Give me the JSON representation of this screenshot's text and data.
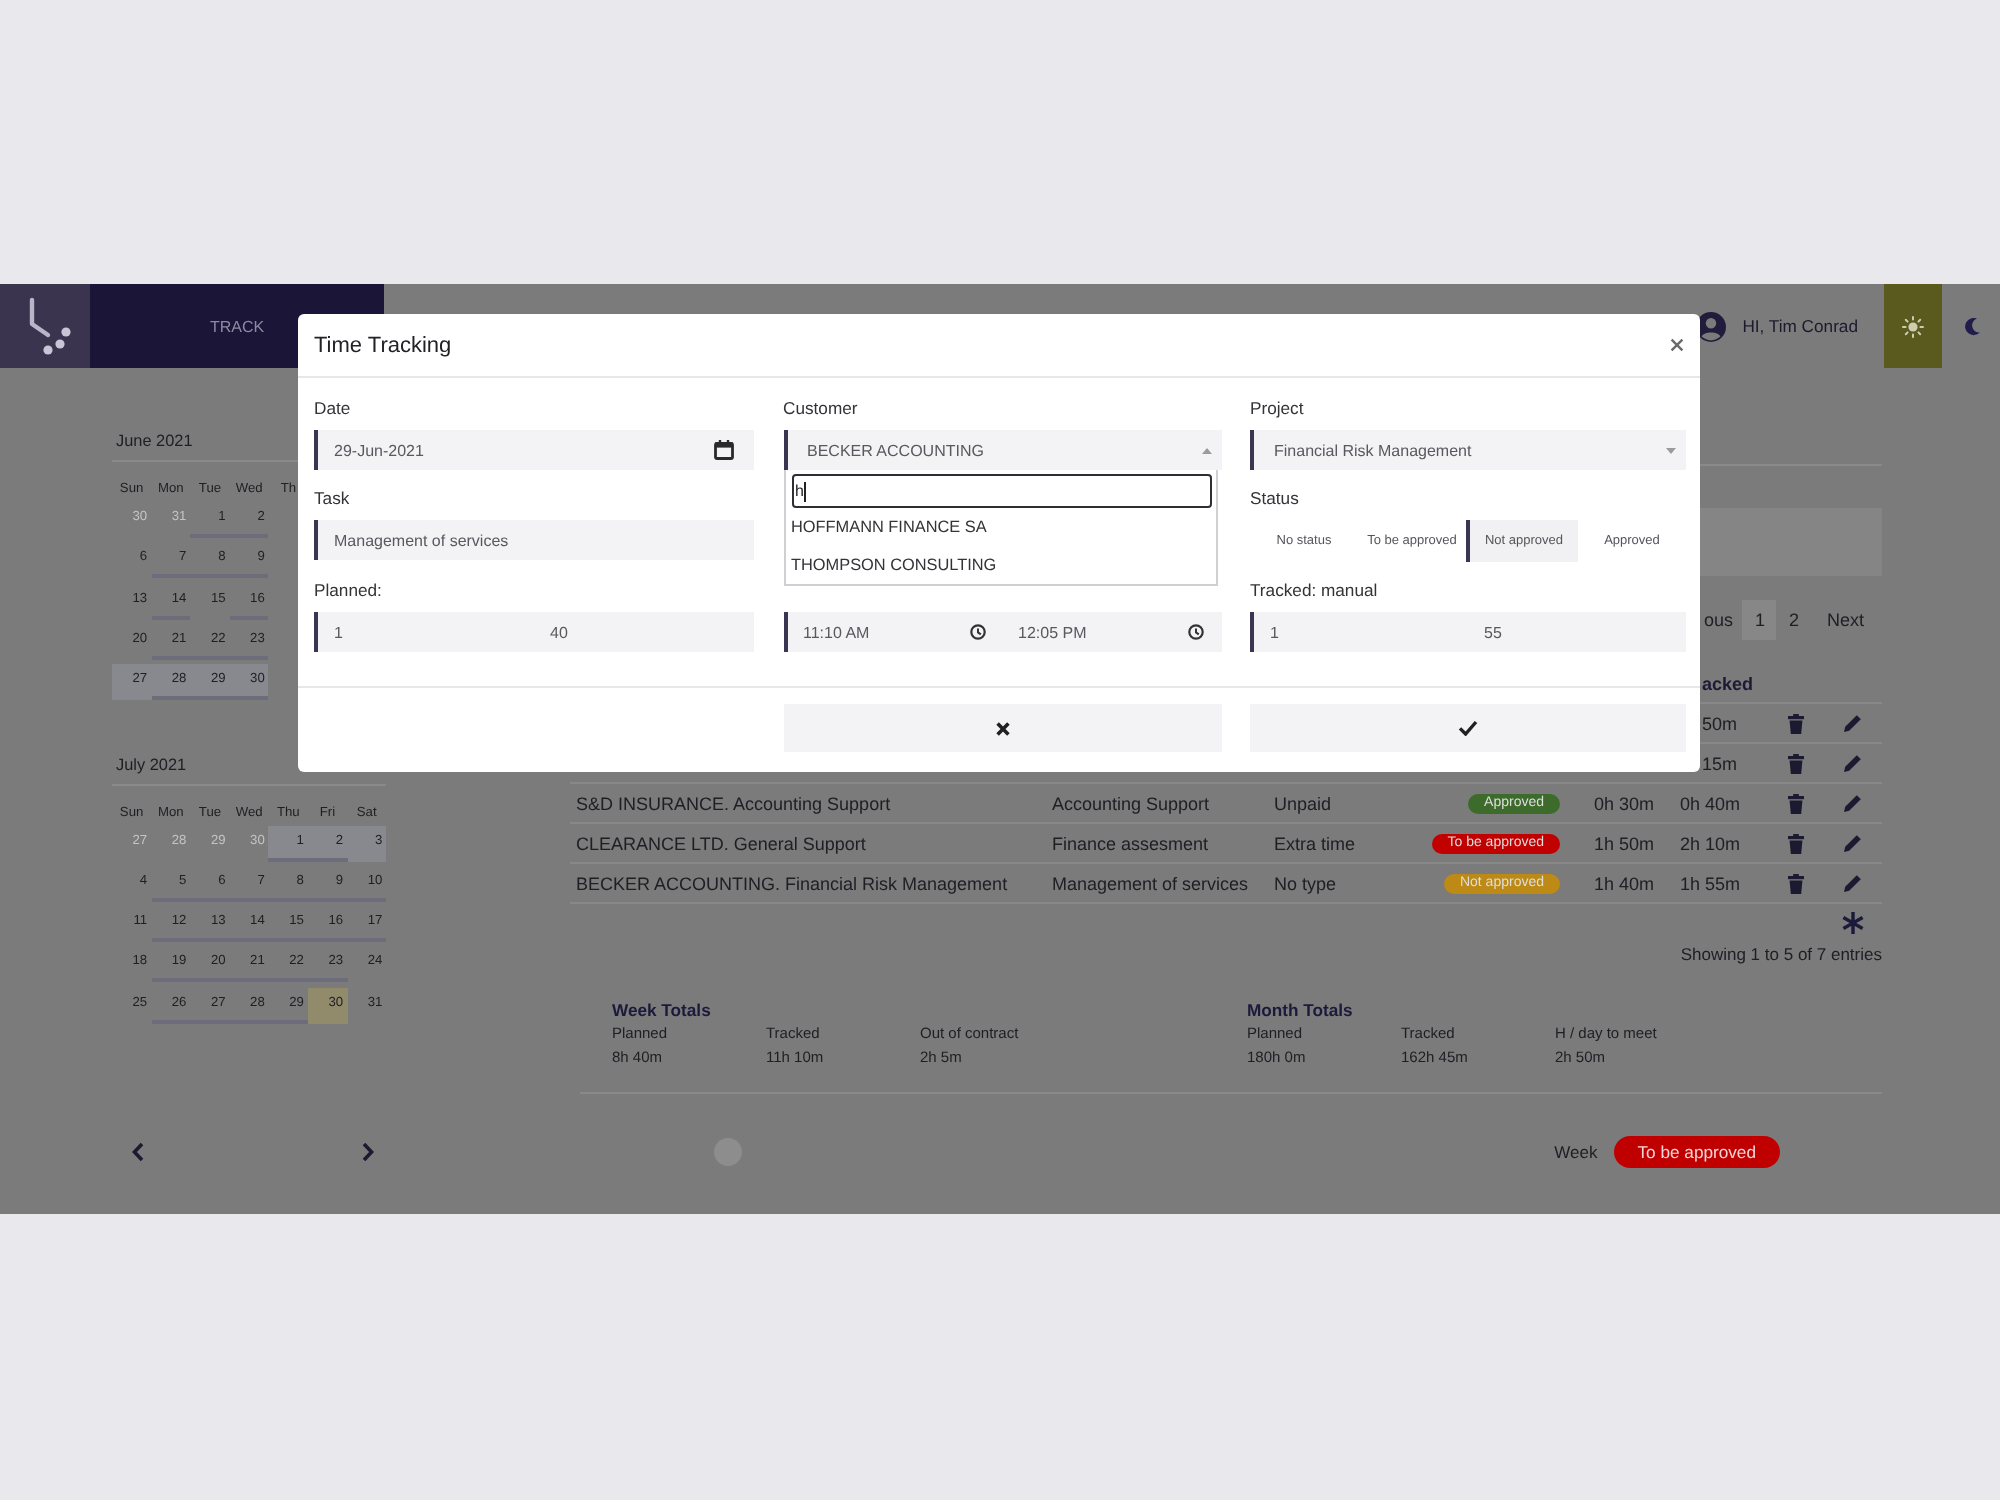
{
  "navbar": {
    "nav_item": "TRACK",
    "greeting": "HI, Tim Conrad",
    "themes": [
      {
        "kind": "light",
        "selected": true
      },
      {
        "kind": "dark",
        "selected": false
      }
    ]
  },
  "calendars": [
    {
      "title": "June 2021",
      "weekdays": [
        "Sun",
        "Mon",
        "Tue",
        "Wed",
        "Th"
      ],
      "weeks": [
        [
          {
            "day": "30",
            "outside": true,
            "logged": false,
            "selected": false,
            "today": false
          },
          {
            "day": "31",
            "outside": true,
            "logged": false,
            "selected": false,
            "today": false
          },
          {
            "day": "1",
            "outside": false,
            "logged": true,
            "selected": false,
            "today": false
          },
          {
            "day": "2",
            "outside": false,
            "logged": true,
            "selected": false,
            "today": false
          }
        ],
        [
          {
            "day": "6",
            "outside": false,
            "logged": false,
            "selected": false,
            "today": false
          },
          {
            "day": "7",
            "outside": false,
            "logged": true,
            "selected": false,
            "today": false
          },
          {
            "day": "8",
            "outside": false,
            "logged": true,
            "selected": false,
            "today": false
          },
          {
            "day": "9",
            "outside": false,
            "logged": true,
            "selected": false,
            "today": false
          }
        ],
        [
          {
            "day": "13",
            "outside": false,
            "logged": false,
            "selected": false,
            "today": false
          },
          {
            "day": "14",
            "outside": false,
            "logged": true,
            "selected": false,
            "today": false
          },
          {
            "day": "15",
            "outside": false,
            "logged": false,
            "selected": false,
            "today": false
          },
          {
            "day": "16",
            "outside": false,
            "logged": true,
            "selected": false,
            "today": false
          }
        ],
        [
          {
            "day": "20",
            "outside": false,
            "logged": false,
            "selected": false,
            "today": false
          },
          {
            "day": "21",
            "outside": false,
            "logged": true,
            "selected": false,
            "today": false
          },
          {
            "day": "22",
            "outside": false,
            "logged": true,
            "selected": false,
            "today": false
          },
          {
            "day": "23",
            "outside": false,
            "logged": true,
            "selected": false,
            "today": false
          }
        ],
        [
          {
            "day": "27",
            "outside": false,
            "logged": false,
            "selected": true,
            "today": false
          },
          {
            "day": "28",
            "outside": false,
            "logged": true,
            "selected": true,
            "today": false
          },
          {
            "day": "29",
            "outside": false,
            "logged": true,
            "selected": true,
            "today": false
          },
          {
            "day": "30",
            "outside": false,
            "logged": true,
            "selected": true,
            "today": false
          }
        ]
      ]
    },
    {
      "title": "July 2021",
      "weekdays": [
        "Sun",
        "Mon",
        "Tue",
        "Wed",
        "Thu",
        "Fri",
        "Sat"
      ],
      "weeks": [
        [
          {
            "day": "27",
            "outside": true,
            "logged": false,
            "selected": false,
            "today": false
          },
          {
            "day": "28",
            "outside": true,
            "logged": false,
            "selected": false,
            "today": false
          },
          {
            "day": "29",
            "outside": true,
            "logged": false,
            "selected": false,
            "today": false
          },
          {
            "day": "30",
            "outside": true,
            "logged": false,
            "selected": false,
            "today": false
          },
          {
            "day": "1",
            "outside": false,
            "logged": true,
            "selected": true,
            "today": false
          },
          {
            "day": "2",
            "outside": false,
            "logged": true,
            "selected": true,
            "today": false
          },
          {
            "day": "3",
            "outside": false,
            "logged": false,
            "selected": true,
            "today": false
          }
        ],
        [
          {
            "day": "4",
            "outside": false,
            "logged": false,
            "selected": false,
            "today": false
          },
          {
            "day": "5",
            "outside": false,
            "logged": true,
            "selected": false,
            "today": false
          },
          {
            "day": "6",
            "outside": false,
            "logged": true,
            "selected": false,
            "today": false
          },
          {
            "day": "7",
            "outside": false,
            "logged": true,
            "selected": false,
            "today": false
          },
          {
            "day": "8",
            "outside": false,
            "logged": true,
            "selected": false,
            "today": false
          },
          {
            "day": "9",
            "outside": false,
            "logged": true,
            "selected": false,
            "today": false
          },
          {
            "day": "10",
            "outside": false,
            "logged": true,
            "selected": false,
            "today": false
          }
        ],
        [
          {
            "day": "11",
            "outside": false,
            "logged": false,
            "selected": false,
            "today": false
          },
          {
            "day": "12",
            "outside": false,
            "logged": true,
            "selected": false,
            "today": false
          },
          {
            "day": "13",
            "outside": false,
            "logged": true,
            "selected": false,
            "today": false
          },
          {
            "day": "14",
            "outside": false,
            "logged": true,
            "selected": false,
            "today": false
          },
          {
            "day": "15",
            "outside": false,
            "logged": true,
            "selected": false,
            "today": false
          },
          {
            "day": "16",
            "outside": false,
            "logged": true,
            "selected": false,
            "today": false
          },
          {
            "day": "17",
            "outside": false,
            "logged": true,
            "selected": false,
            "today": false
          }
        ],
        [
          {
            "day": "18",
            "outside": false,
            "logged": false,
            "selected": false,
            "today": false
          },
          {
            "day": "19",
            "outside": false,
            "logged": true,
            "selected": false,
            "today": false
          },
          {
            "day": "20",
            "outside": false,
            "logged": true,
            "selected": false,
            "today": false
          },
          {
            "day": "21",
            "outside": false,
            "logged": true,
            "selected": false,
            "today": false
          },
          {
            "day": "22",
            "outside": false,
            "logged": true,
            "selected": false,
            "today": false
          },
          {
            "day": "23",
            "outside": false,
            "logged": true,
            "selected": false,
            "today": false
          },
          {
            "day": "24",
            "outside": false,
            "logged": false,
            "selected": false,
            "today": false
          }
        ],
        [
          {
            "day": "25",
            "outside": false,
            "logged": false,
            "selected": false,
            "today": false
          },
          {
            "day": "26",
            "outside": false,
            "logged": true,
            "selected": false,
            "today": false
          },
          {
            "day": "27",
            "outside": false,
            "logged": true,
            "selected": false,
            "today": false
          },
          {
            "day": "28",
            "outside": false,
            "logged": true,
            "selected": false,
            "today": false
          },
          {
            "day": "29",
            "outside": false,
            "logged": true,
            "selected": false,
            "today": false
          },
          {
            "day": "30",
            "outside": false,
            "logged": false,
            "selected": false,
            "today": true
          },
          {
            "day": "31",
            "outside": false,
            "logged": false,
            "selected": false,
            "today": false
          }
        ]
      ]
    }
  ],
  "entries": {
    "pagination": {
      "previous": "ous",
      "pages": [
        {
          "label": "1",
          "selected": true
        },
        {
          "label": "2",
          "selected": false
        }
      ],
      "next": "Next"
    },
    "header": "acked",
    "rows": [
      {
        "kind": "partial",
        "tracked": "50m"
      },
      {
        "kind": "partial",
        "tracked": "15m"
      },
      {
        "kind": "full",
        "project": "S&D INSURANCE. Accounting Support",
        "task": "Accounting Support",
        "type": "Unpaid",
        "status": "Approved",
        "color": "#3d6b2c",
        "planned": "0h 30m",
        "tracked": "0h 40m"
      },
      {
        "kind": "full",
        "project": "CLEARANCE LTD. General Support",
        "task": "Finance assesment",
        "type": "Extra time",
        "status": "To be approved",
        "color": "#c10000",
        "planned": "1h 50m",
        "tracked": "2h 10m"
      },
      {
        "kind": "full",
        "project": "BECKER ACCOUNTING. Financial Risk Management",
        "task": "Management of services",
        "type": "No type",
        "status": "Not approved",
        "color": "#bd8a16",
        "planned": "1h 40m",
        "tracked": "1h 55m"
      }
    ],
    "summary": "Showing 1 to 5 of 7 entries"
  },
  "totals": [
    {
      "title": "Week Totals",
      "items": [
        {
          "label": "Planned",
          "value": "8h 40m"
        },
        {
          "label": "Tracked",
          "value": "11h 10m"
        },
        {
          "label": "Out of contract",
          "value": "2h 5m"
        }
      ]
    },
    {
      "title": "Month Totals",
      "items": [
        {
          "label": "Planned",
          "value": "180h 0m"
        },
        {
          "label": "Tracked",
          "value": "162h 45m"
        },
        {
          "label": "H / day to meet",
          "value": "2h 50m"
        }
      ]
    }
  ],
  "week_status": {
    "label": "Week",
    "status": "To be approved",
    "color": "#c00000"
  },
  "modal": {
    "title": "Time Tracking",
    "date": {
      "label": "Date",
      "value": "29-Jun-2021"
    },
    "customer": {
      "label": "Customer",
      "value": "BECKER ACCOUNTING",
      "expanded": true,
      "search": "h",
      "options": [
        "HOFFMANN FINANCE SA",
        "THOMPSON CONSULTING"
      ]
    },
    "project": {
      "label": "Project",
      "value": "Financial Risk Management",
      "expanded": false
    },
    "task": {
      "label": "Task",
      "value": "Management of services"
    },
    "status": {
      "label": "Status",
      "options": [
        {
          "label": "No status",
          "selected": false
        },
        {
          "label": "To be approved",
          "selected": false
        },
        {
          "label": "Not approved",
          "selected": true
        },
        {
          "label": "Approved",
          "selected": false
        }
      ]
    },
    "planned": {
      "label": "Planned:",
      "hours": "1",
      "minutes": "40"
    },
    "clock": {
      "start": "11:10 AM",
      "end": "12:05 PM"
    },
    "manual": {
      "label": "Tracked: manual",
      "hours": "1",
      "minutes": "55"
    }
  }
}
